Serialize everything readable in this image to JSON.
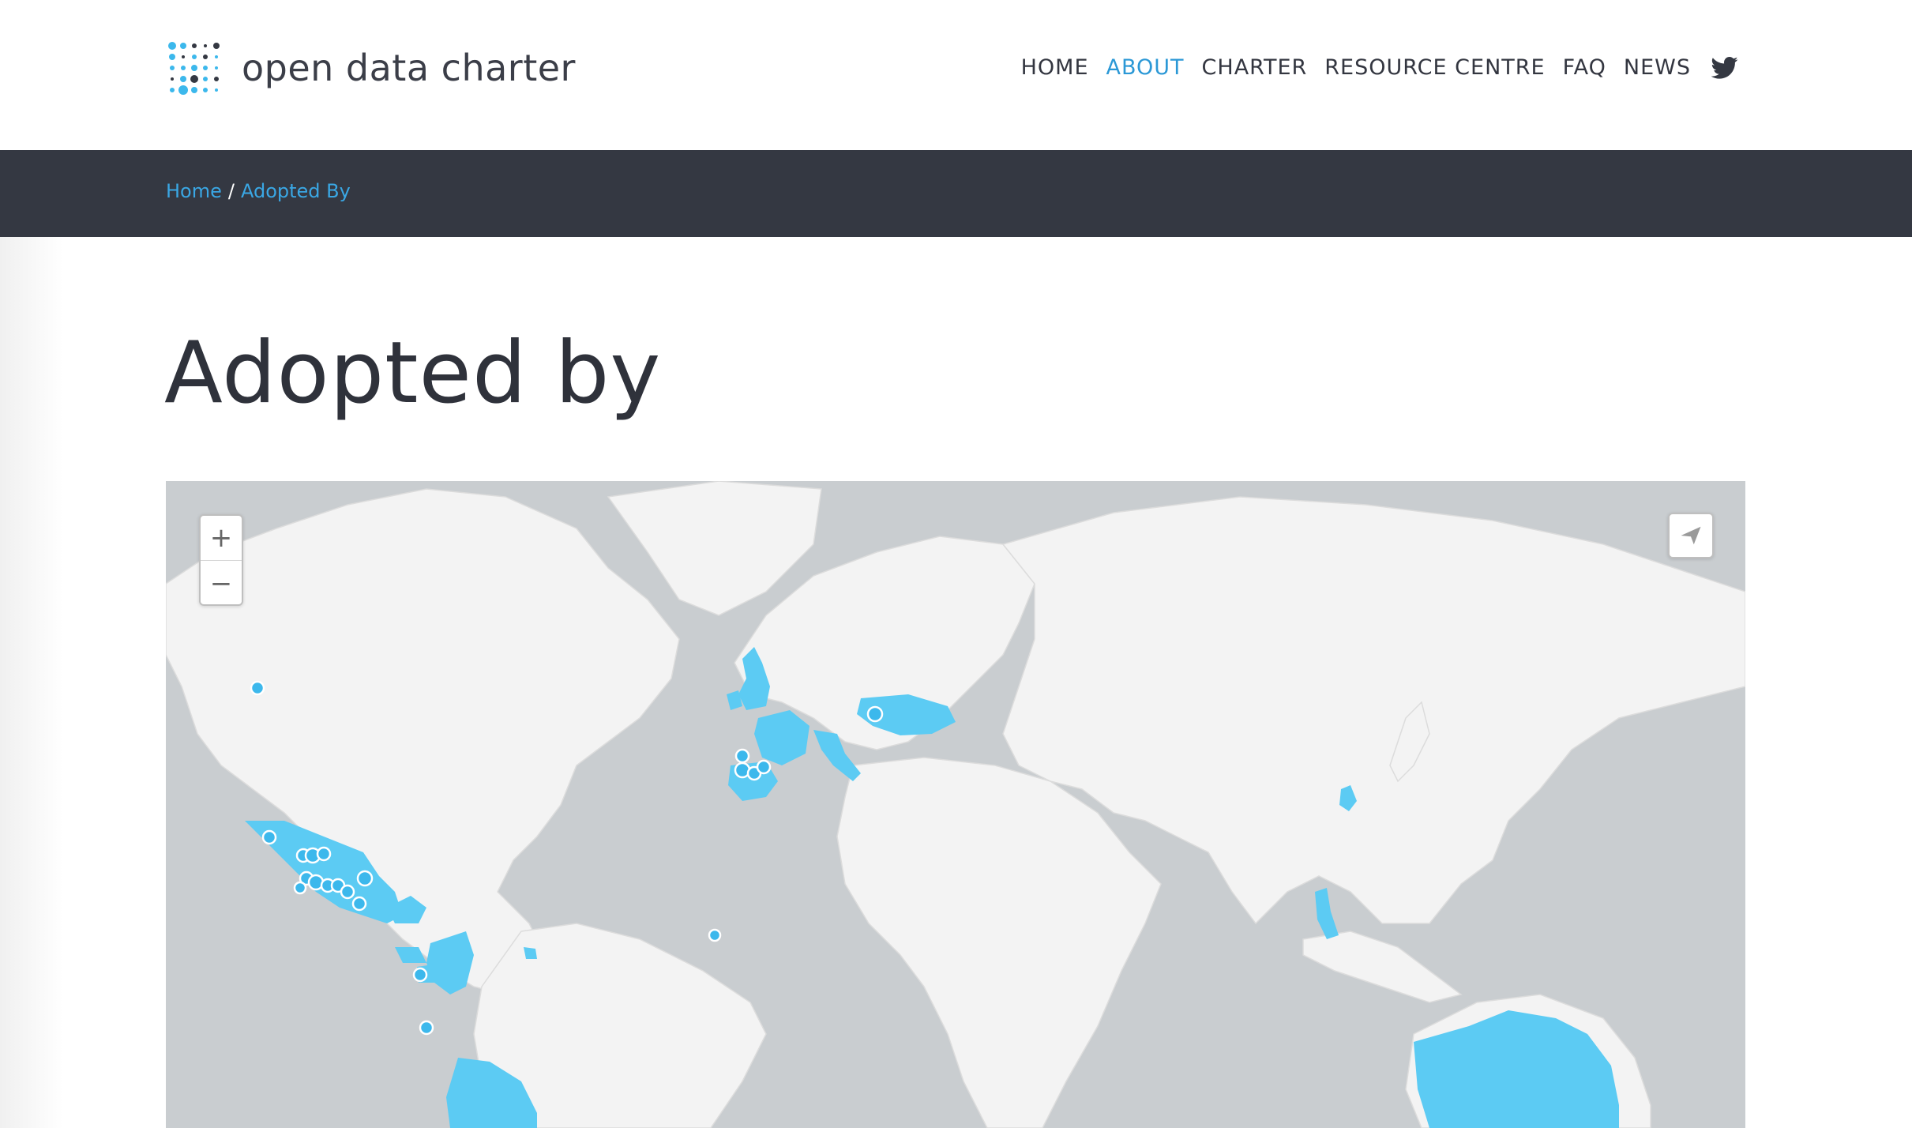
{
  "brand": {
    "name": "open data charter"
  },
  "nav": {
    "items": [
      {
        "label": "HOME",
        "active": false
      },
      {
        "label": "ABOUT",
        "active": true
      },
      {
        "label": "CHARTER",
        "active": false
      },
      {
        "label": "RESOURCE CENTRE",
        "active": false
      },
      {
        "label": "FAQ",
        "active": false
      },
      {
        "label": "NEWS",
        "active": false
      }
    ],
    "social_icon": "twitter-icon"
  },
  "breadcrumb": {
    "home": "Home",
    "separator": "/",
    "current": "Adopted By"
  },
  "page": {
    "title": "Adopted by"
  },
  "map": {
    "zoom_in": "+",
    "zoom_out": "−",
    "locate_icon": "paper-plane-icon",
    "colors": {
      "ocean": "#c9cdd0",
      "land": "#f3f3f3",
      "adopted": "#5ccbf3",
      "marker": "#3cb8ec"
    }
  },
  "colors": {
    "accent": "#2b98d6",
    "dark_bar": "#343842",
    "text": "#333640"
  }
}
